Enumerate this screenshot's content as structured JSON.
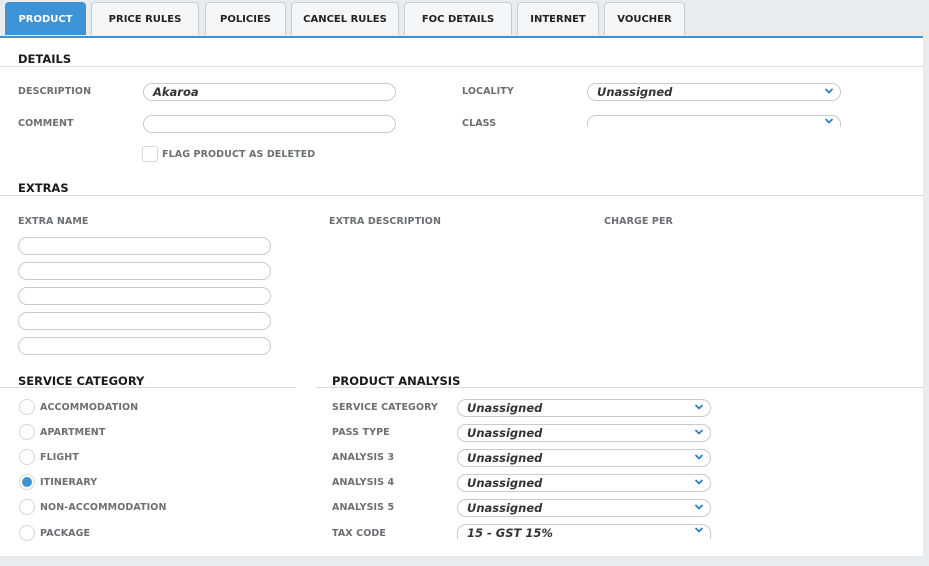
{
  "tabs": [
    "PRODUCT",
    "PRICE RULES",
    "POLICIES",
    "CANCEL RULES",
    "FOC DETAILS",
    "INTERNET",
    "VOUCHER"
  ],
  "details": {
    "title": "DETAILS",
    "description_label": "DESCRIPTION",
    "description_value": "Akaroa",
    "comment_label": "COMMENT",
    "comment_value": "",
    "locality_label": "LOCALITY",
    "locality_value": "Unassigned",
    "class_label": "CLASS",
    "class_value": "",
    "flag_label": "FLAG PRODUCT AS DELETED"
  },
  "extras": {
    "title": "EXTRAS",
    "col_name": "EXTRA NAME",
    "col_description": "EXTRA DESCRIPTION",
    "col_charge": "CHARGE PER",
    "rows": [
      "",
      "",
      "",
      "",
      ""
    ]
  },
  "service_category": {
    "title": "SERVICE CATEGORY",
    "options": [
      "ACCOMMODATION",
      "APARTMENT",
      "FLIGHT",
      "ITINERARY",
      "NON-ACCOMMODATION",
      "PACKAGE"
    ],
    "selected": "ITINERARY"
  },
  "product_analysis": {
    "title": "PRODUCT ANALYSIS",
    "fields": [
      {
        "label": "SERVICE CATEGORY",
        "value": "Unassigned"
      },
      {
        "label": "PASS TYPE",
        "value": "Unassigned"
      },
      {
        "label": "ANALYSIS 3",
        "value": "Unassigned"
      },
      {
        "label": "ANALYSIS 4",
        "value": "Unassigned"
      },
      {
        "label": "ANALYSIS 5",
        "value": "Unassigned"
      },
      {
        "label": "TAX CODE",
        "value": "15 - GST 15%"
      }
    ]
  },
  "icons": {
    "dropdown": "chevron-down-icon",
    "accent": "#3d93d6"
  }
}
